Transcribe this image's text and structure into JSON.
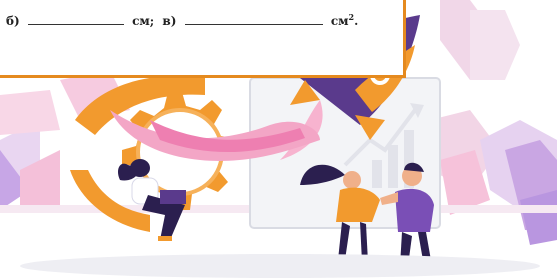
{
  "worksheet": {
    "item_b_label": "б)",
    "unit_cm": "см;",
    "item_c_label": "в)",
    "unit_cm2_base": "см",
    "unit_cm2_exp": "2",
    "end_dot": "."
  },
  "colors": {
    "accent_orange": "#f29a2e",
    "border_orange": "#e58a1f",
    "pink": "#f1a7c8",
    "purple": "#5a3a8c",
    "lavender": "#d9c8ee",
    "board": "#f3f4f7"
  },
  "icons": {
    "gear": "gear-icon",
    "rocket": "rocket-icon",
    "chart": "rising-chart-icon",
    "laptop": "laptop-icon"
  }
}
